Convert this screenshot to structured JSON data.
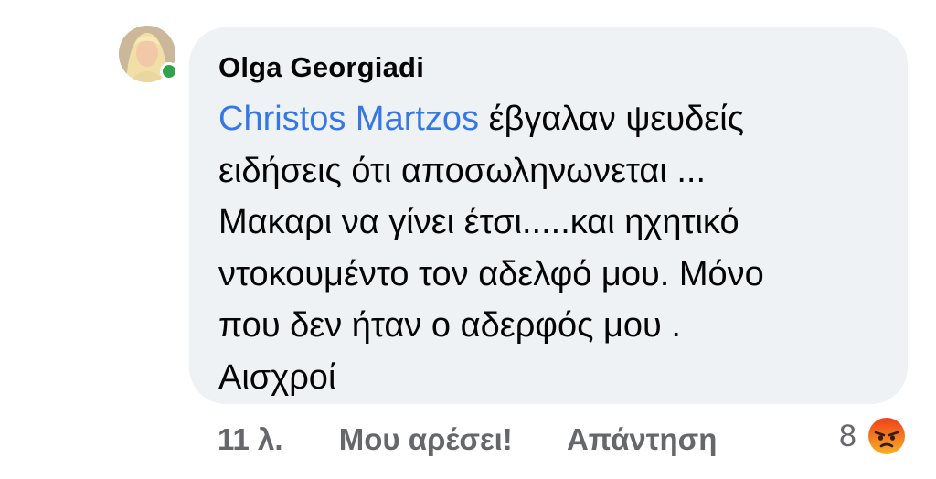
{
  "comment": {
    "author": "Olga Georgiadi",
    "mention": "Christos Martzos",
    "lines": [
      " έβγαλαν ψευδείς",
      "ειδήσεις ότι αποσωληνωνεται ...",
      "Μακαρι να γίνει έτσι.....και ηχητικό",
      "ντοκουμέντο τον αδελφό μου. Μόνο",
      "που δεν ήταν ο αδερφός μου .",
      "Αισχροί"
    ],
    "online": true
  },
  "actions": {
    "time": "11 λ.",
    "like_label": "Μου αρέσει!",
    "reply_label": "Απάντηση"
  },
  "reactions": {
    "count": "8",
    "icon": "angry-emoji-icon"
  },
  "colors": {
    "bubble": "#eff2f5",
    "mention": "#3578e5",
    "online": "#31a24c",
    "secondary_text": "#65676b",
    "angry": "#f0651c"
  }
}
